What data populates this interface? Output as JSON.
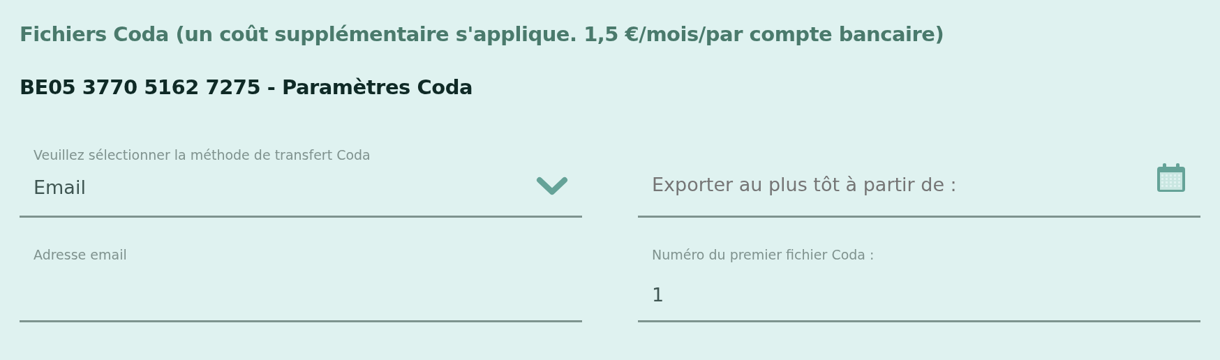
{
  "section_title": "Fichiers Coda (un coût supplémentaire s'applique. 1,5 €/mois/par compte bancaire)",
  "account_heading": "BE05 3770 5162 7275 - Paramètres Coda",
  "fields": [
    {
      "kind": "select",
      "label": "Veuillez sélectionner la méthode de transfert Coda",
      "value": "Email"
    },
    {
      "kind": "date",
      "placeholder": "Exporter au plus tôt à partir de :"
    },
    {
      "kind": "text",
      "label": "Adresse email"
    },
    {
      "kind": "text",
      "label": "Numéro du premier fichier Coda :",
      "value": "1"
    }
  ]
}
